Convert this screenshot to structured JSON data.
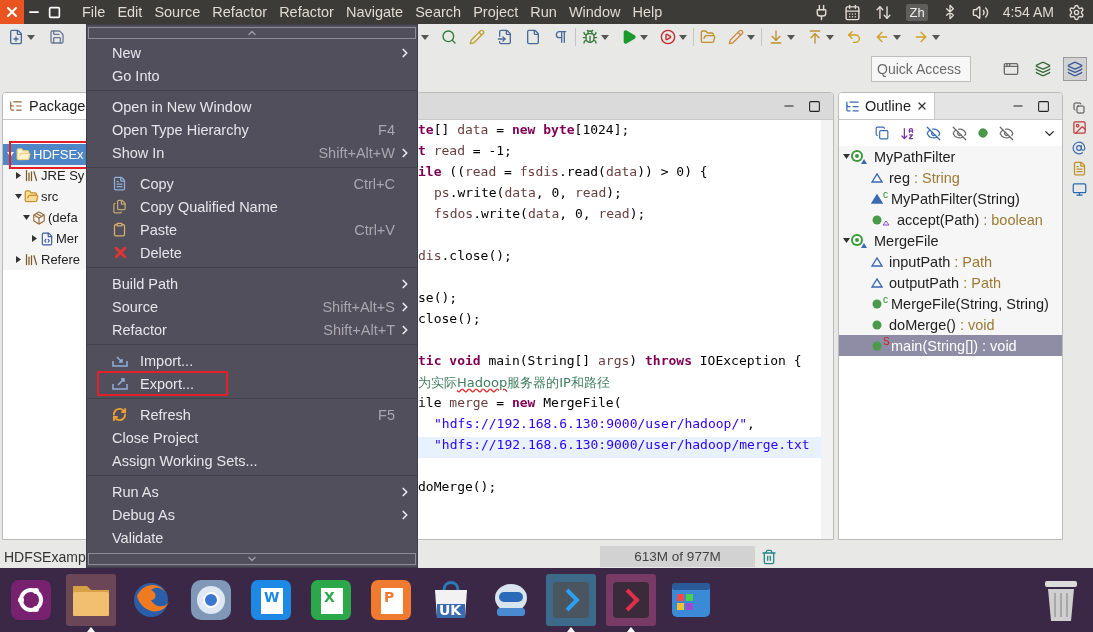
{
  "top_bar": {
    "menus": [
      "File",
      "Edit",
      "Source",
      "Refactor",
      "Refactor",
      "Navigate",
      "Search",
      "Project",
      "Run",
      "Window",
      "Help"
    ],
    "input_method": "Zh",
    "clock": "4:54 AM"
  },
  "quick_access": {
    "placeholder": "Quick Access"
  },
  "package_explorer": {
    "title": "Package",
    "tree": [
      {
        "label": "HDFSEx",
        "kind": "project",
        "selected": true,
        "boxed": true,
        "expanded": true,
        "children": [
          {
            "label": "JRE Sy",
            "kind": "library",
            "selected": false,
            "boxed": false,
            "expanded": false
          },
          {
            "label": "src",
            "kind": "folder",
            "selected": false,
            "boxed": false,
            "expanded": true,
            "children": [
              {
                "label": "(defa",
                "kind": "package",
                "selected": false,
                "boxed": false,
                "expanded": true,
                "children": [
                  {
                    "label": "Mer",
                    "kind": "java",
                    "selected": false,
                    "boxed": false,
                    "expanded": false
                  }
                ]
              }
            ]
          },
          {
            "label": "Refere",
            "kind": "library",
            "selected": false,
            "boxed": false,
            "expanded": false
          }
        ]
      }
    ]
  },
  "context_menu": {
    "sections": [
      {
        "items": [
          {
            "label": "New",
            "kind": "plain",
            "submenu": true,
            "boxed": false
          },
          {
            "label": "Go Into",
            "kind": "plain",
            "submenu": false,
            "boxed": false
          }
        ]
      },
      {
        "items": [
          {
            "label": "Open in New Window",
            "kind": "plain",
            "submenu": false,
            "boxed": false
          },
          {
            "label": "Open Type Hierarchy",
            "kind": "plain",
            "shortcut": "F4",
            "submenu": false,
            "boxed": false
          },
          {
            "label": "Show In",
            "kind": "plain",
            "shortcut": "Shift+Alt+W",
            "submenu": true,
            "boxed": false
          }
        ]
      },
      {
        "items": [
          {
            "label": "Copy",
            "kind": "copy",
            "shortcut": "Ctrl+C",
            "submenu": false,
            "boxed": false
          },
          {
            "label": "Copy Qualified Name",
            "kind": "copy-name",
            "submenu": false,
            "boxed": false
          },
          {
            "label": "Paste",
            "kind": "paste",
            "shortcut": "Ctrl+V",
            "submenu": false,
            "boxed": false
          },
          {
            "label": "Delete",
            "kind": "delete",
            "submenu": false,
            "boxed": false
          }
        ]
      },
      {
        "items": [
          {
            "label": "Build Path",
            "kind": "plain",
            "submenu": true,
            "boxed": false
          },
          {
            "label": "Source",
            "kind": "plain",
            "shortcut": "Shift+Alt+S",
            "submenu": true,
            "boxed": false
          },
          {
            "label": "Refactor",
            "kind": "plain",
            "shortcut": "Shift+Alt+T",
            "submenu": true,
            "boxed": false
          }
        ]
      },
      {
        "items": [
          {
            "label": "Import...",
            "kind": "import",
            "submenu": false,
            "boxed": false
          },
          {
            "label": "Export...",
            "kind": "export",
            "submenu": false,
            "boxed": true
          }
        ]
      },
      {
        "items": [
          {
            "label": "Refresh",
            "kind": "refresh",
            "shortcut": "F5",
            "submenu": false,
            "boxed": false
          },
          {
            "label": "Close Project",
            "kind": "plain",
            "submenu": false,
            "boxed": false
          },
          {
            "label": "Assign Working Sets...",
            "kind": "plain",
            "submenu": false,
            "boxed": false
          }
        ]
      },
      {
        "items": [
          {
            "label": "Run As",
            "kind": "plain",
            "submenu": true,
            "boxed": false
          },
          {
            "label": "Debug As",
            "kind": "plain",
            "submenu": true,
            "boxed": false
          },
          {
            "label": "Validate",
            "kind": "plain",
            "submenu": false,
            "boxed": false
          }
        ]
      }
    ]
  },
  "editor": {
    "lines": [
      {
        "current": false,
        "indented": false,
        "segments": [
          {
            "kind": "kw",
            "text": "te"
          },
          {
            "kind": "plain",
            "text": "[] "
          },
          {
            "kind": "var",
            "text": "data"
          },
          {
            "kind": "plain",
            "text": " = "
          },
          {
            "kind": "kw",
            "text": "new byte"
          },
          {
            "kind": "plain",
            "text": "[1024];"
          }
        ]
      },
      {
        "current": false,
        "indented": false,
        "segments": [
          {
            "kind": "kw",
            "text": "t"
          },
          {
            "kind": "var",
            "text": " read"
          },
          {
            "kind": "plain",
            "text": " = -1;"
          }
        ]
      },
      {
        "current": false,
        "indented": false,
        "segments": [
          {
            "kind": "kw",
            "text": "ile"
          },
          {
            "kind": "plain",
            "text": " (("
          },
          {
            "kind": "var",
            "text": "read"
          },
          {
            "kind": "plain",
            "text": " = "
          },
          {
            "kind": "var",
            "text": "fsdis"
          },
          {
            "kind": "plain",
            "text": ".read("
          },
          {
            "kind": "var",
            "text": "data"
          },
          {
            "kind": "plain",
            "text": ")) > 0) {"
          }
        ]
      },
      {
        "current": false,
        "indented": true,
        "segments": [
          {
            "kind": "var",
            "text": "ps"
          },
          {
            "kind": "plain",
            "text": ".write("
          },
          {
            "kind": "var",
            "text": "data"
          },
          {
            "kind": "plain",
            "text": ", 0, "
          },
          {
            "kind": "var",
            "text": "read"
          },
          {
            "kind": "plain",
            "text": ");"
          }
        ]
      },
      {
        "current": false,
        "indented": true,
        "segments": [
          {
            "kind": "var",
            "text": "fsdos"
          },
          {
            "kind": "plain",
            "text": ".write("
          },
          {
            "kind": "var",
            "text": "data"
          },
          {
            "kind": "plain",
            "text": ", 0, "
          },
          {
            "kind": "var",
            "text": "read"
          },
          {
            "kind": "plain",
            "text": ");"
          }
        ]
      },
      {
        "current": false
      },
      {
        "current": false,
        "indented": false,
        "segments": [
          {
            "kind": "var",
            "text": "dis"
          },
          {
            "kind": "plain",
            "text": ".close();"
          }
        ]
      },
      {
        "current": false
      },
      {
        "current": false,
        "indented": false,
        "segments": [
          {
            "kind": "plain",
            "text": "se();"
          }
        ]
      },
      {
        "current": false,
        "indented": false,
        "segments": [
          {
            "kind": "plain",
            "text": "close();"
          }
        ]
      },
      {
        "current": false
      },
      {
        "current": false,
        "indented": false,
        "segments": [
          {
            "kind": "kw",
            "text": "tic void"
          },
          {
            "kind": "plain",
            "text": " main(String[] "
          },
          {
            "kind": "var",
            "text": "args"
          },
          {
            "kind": "plain",
            "text": ") "
          },
          {
            "kind": "kw",
            "text": "throws"
          },
          {
            "kind": "plain",
            "text": " IOException {"
          }
        ]
      },
      {
        "current": false,
        "indented": false,
        "segments": [
          {
            "kind": "cmt",
            "text": "为实际"
          },
          {
            "kind": "typo",
            "text": "Hadoop"
          },
          {
            "kind": "cmt",
            "text": "服务器的IP和路径"
          }
        ]
      },
      {
        "current": false,
        "indented": false,
        "segments": [
          {
            "kind": "plain",
            "text": "ile "
          },
          {
            "kind": "var",
            "text": "merge"
          },
          {
            "kind": "plain",
            "text": " = "
          },
          {
            "kind": "kw",
            "text": "new"
          },
          {
            "kind": "plain",
            "text": " MergeFile("
          }
        ]
      },
      {
        "current": false,
        "indented": true,
        "segments": [
          {
            "kind": "str",
            "text": "\"hdfs://192.168.6.130:9000/user/hadoop/\""
          },
          {
            "kind": "plain",
            "text": ","
          }
        ]
      },
      {
        "current": true,
        "indented": true,
        "segments": [
          {
            "kind": "str",
            "text": "\"hdfs://192.168.6.130:9000/user/hadoop/merge.txt"
          }
        ]
      },
      {
        "current": false
      },
      {
        "current": false,
        "indented": false,
        "segments": [
          {
            "kind": "plain",
            "text": "doMerge();"
          }
        ]
      }
    ]
  },
  "outline": {
    "title": "Outline",
    "items": [
      {
        "name": "MyPathFilter",
        "kind": "class",
        "expanded": true,
        "selected": false,
        "children": [
          {
            "name": "reg",
            "type": ": String",
            "kind": "field",
            "selected": false
          },
          {
            "name": "MyPathFilter(String)",
            "badge": "c",
            "kind": "constructor",
            "selected": false
          },
          {
            "name": "accept(Path)",
            "type": ": boolean",
            "kind": "override",
            "selected": false
          }
        ]
      },
      {
        "name": "MergeFile",
        "kind": "class",
        "expanded": true,
        "selected": false,
        "children": [
          {
            "name": "inputPath",
            "type": ": Path",
            "kind": "field",
            "selected": false
          },
          {
            "name": "outputPath",
            "type": ": Path",
            "kind": "field",
            "selected": false
          },
          {
            "name": "MergeFile(String, String)",
            "badge": "c",
            "kind": "method",
            "selected": false
          },
          {
            "name": "doMerge()",
            "type": ": void",
            "kind": "method",
            "selected": false
          },
          {
            "name": "main(String[])",
            "type": ": void",
            "badge": "S",
            "kind": "method",
            "selected": true
          }
        ]
      }
    ]
  },
  "status_bar": {
    "selection": "HDFSExamp",
    "memory": "613M of 977M"
  },
  "dock": {
    "items": [
      {
        "kind": "launcher",
        "active": false
      },
      {
        "kind": "files",
        "active": true
      },
      {
        "kind": "fox-browser",
        "active": false
      },
      {
        "kind": "browser",
        "active": false
      },
      {
        "kind": "word",
        "label": "W",
        "active": false
      },
      {
        "kind": "spreadsheet",
        "label": "X",
        "active": false
      },
      {
        "kind": "slides",
        "label": "P",
        "active": false
      },
      {
        "kind": "store",
        "label": "UK",
        "active": false
      },
      {
        "kind": "robot",
        "active": false
      },
      {
        "kind": "code",
        "active": true
      },
      {
        "kind": "terminal",
        "active": true
      },
      {
        "kind": "grid",
        "active": false
      }
    ]
  }
}
